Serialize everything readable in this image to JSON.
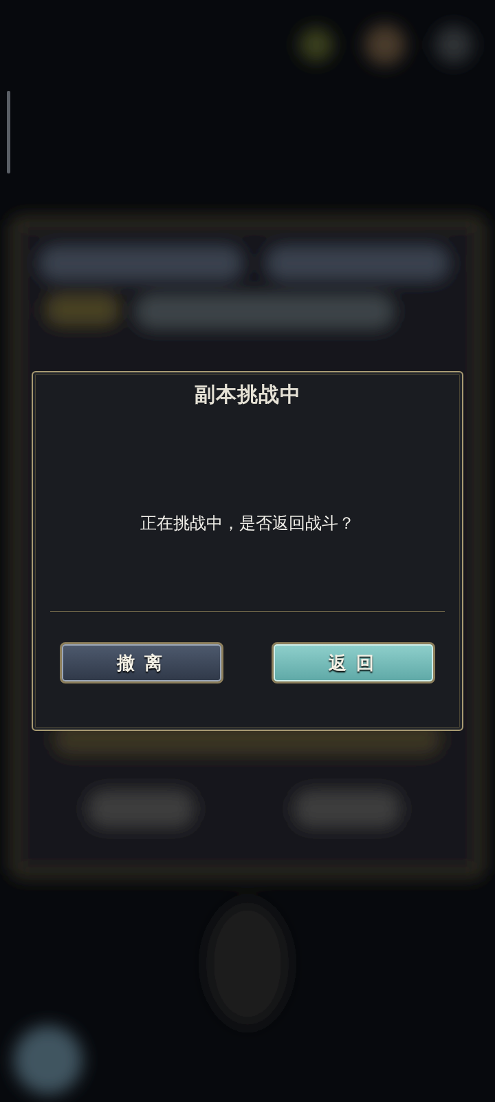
{
  "dialog": {
    "title": "副本挑战中",
    "message": "正在挑战中，是否返回战斗？",
    "buttons": [
      {
        "label": "撤离",
        "kind": "secondary"
      },
      {
        "label": "返回",
        "kind": "primary"
      }
    ]
  }
}
